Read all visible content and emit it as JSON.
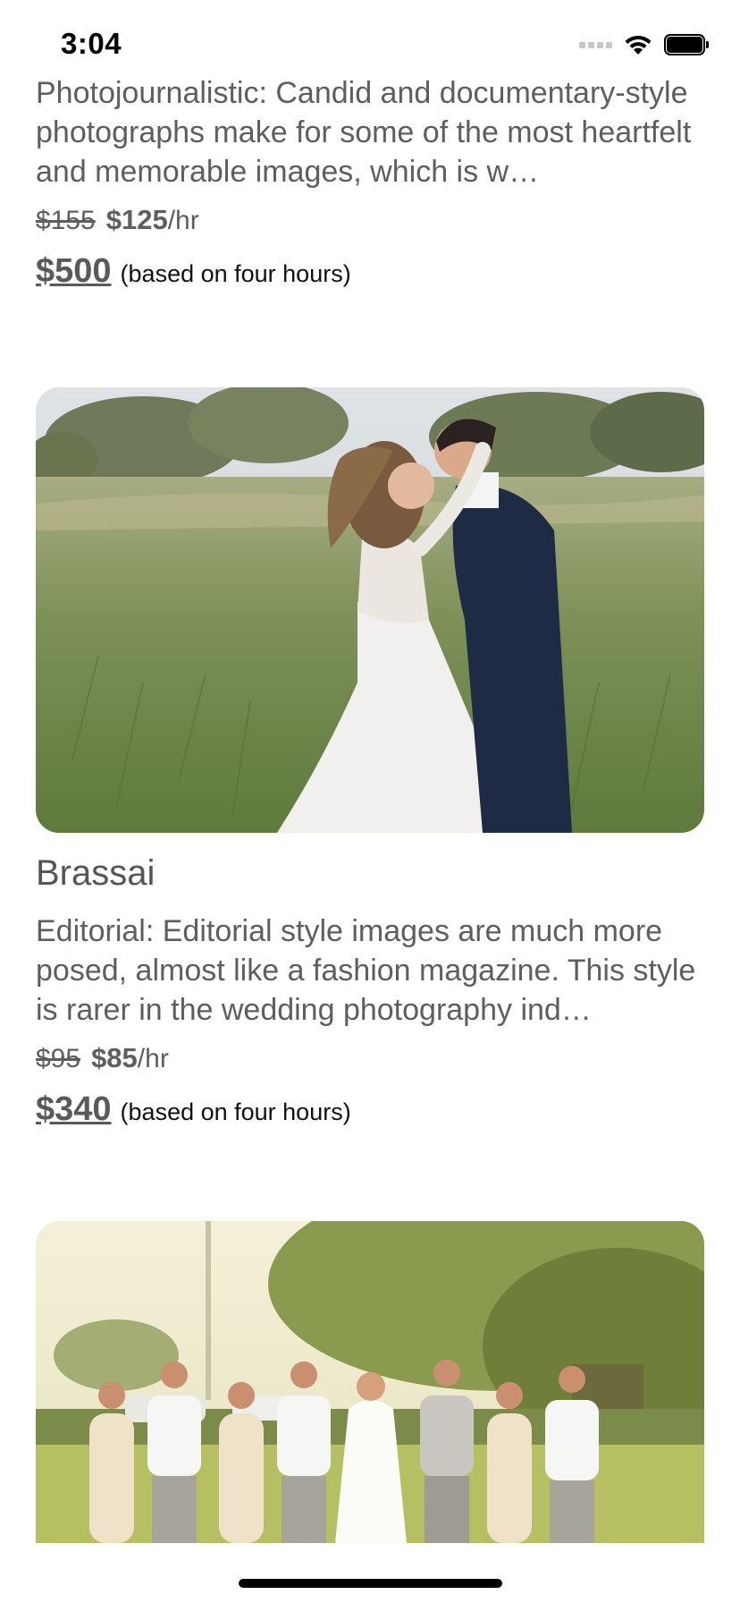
{
  "status_bar": {
    "time": "3:04",
    "signal_icon": "cellular-signal-icon",
    "wifi_icon": "wifi-icon",
    "battery_icon": "battery-icon"
  },
  "listings": [
    {
      "description": "Photojournalistic: Candid and documentary-style photographs make for some of the most heartfelt and memorable images, which is w…",
      "old_rate": "$155",
      "new_rate": "$125",
      "rate_unit": "/hr",
      "total": "$500",
      "total_note": "(based on four hours)"
    },
    {
      "image": "couple-in-field-photo",
      "title": "Brassai",
      "description": "Editorial: Editorial style images are much more posed, almost like a fashion magazine. This style is rarer in the wedding photography ind…",
      "old_rate": "$95",
      "new_rate": "$85",
      "rate_unit": "/hr",
      "total": "$340",
      "total_note": "(based on four hours)"
    },
    {
      "image": "wedding-party-photo"
    }
  ]
}
